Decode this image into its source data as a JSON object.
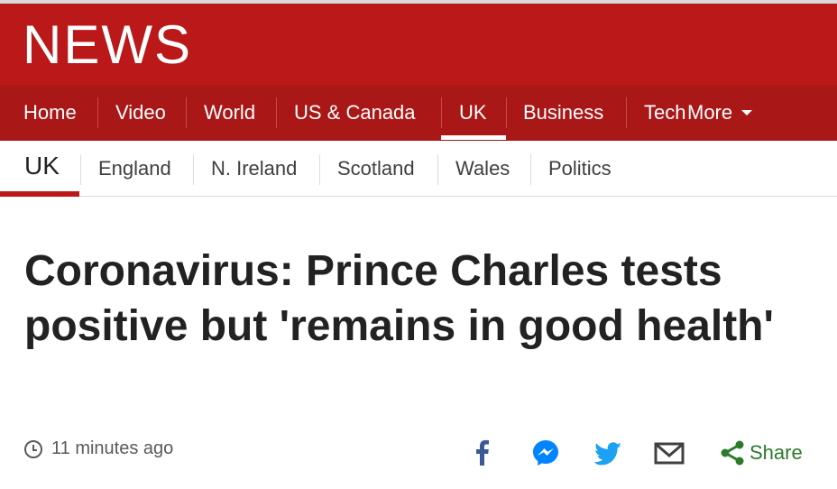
{
  "site": {
    "logo": "NEWS"
  },
  "primary_nav": {
    "items": [
      "Home",
      "Video",
      "World",
      "US & Canada",
      "UK",
      "Business",
      "Tech"
    ],
    "active": "UK",
    "more_label": "More"
  },
  "secondary_nav": {
    "title": "UK",
    "items": [
      "England",
      "N. Ireland",
      "Scotland",
      "Wales",
      "Politics"
    ]
  },
  "article": {
    "headline": "Coronavirus: Prince Charles tests positive but 'remains in good health'",
    "timestamp": "11 minutes ago"
  },
  "share": {
    "label": "Share",
    "icons": [
      "facebook-icon",
      "messenger-icon",
      "twitter-icon",
      "email-icon",
      "share-icon"
    ]
  },
  "colors": {
    "brand_red": "#bb1919",
    "nav_red": "#a91717",
    "facebook": "#3b5998",
    "messenger": "#0084ff",
    "twitter": "#1da1f2",
    "email": "#404040",
    "share_green": "#2c7a2c"
  }
}
